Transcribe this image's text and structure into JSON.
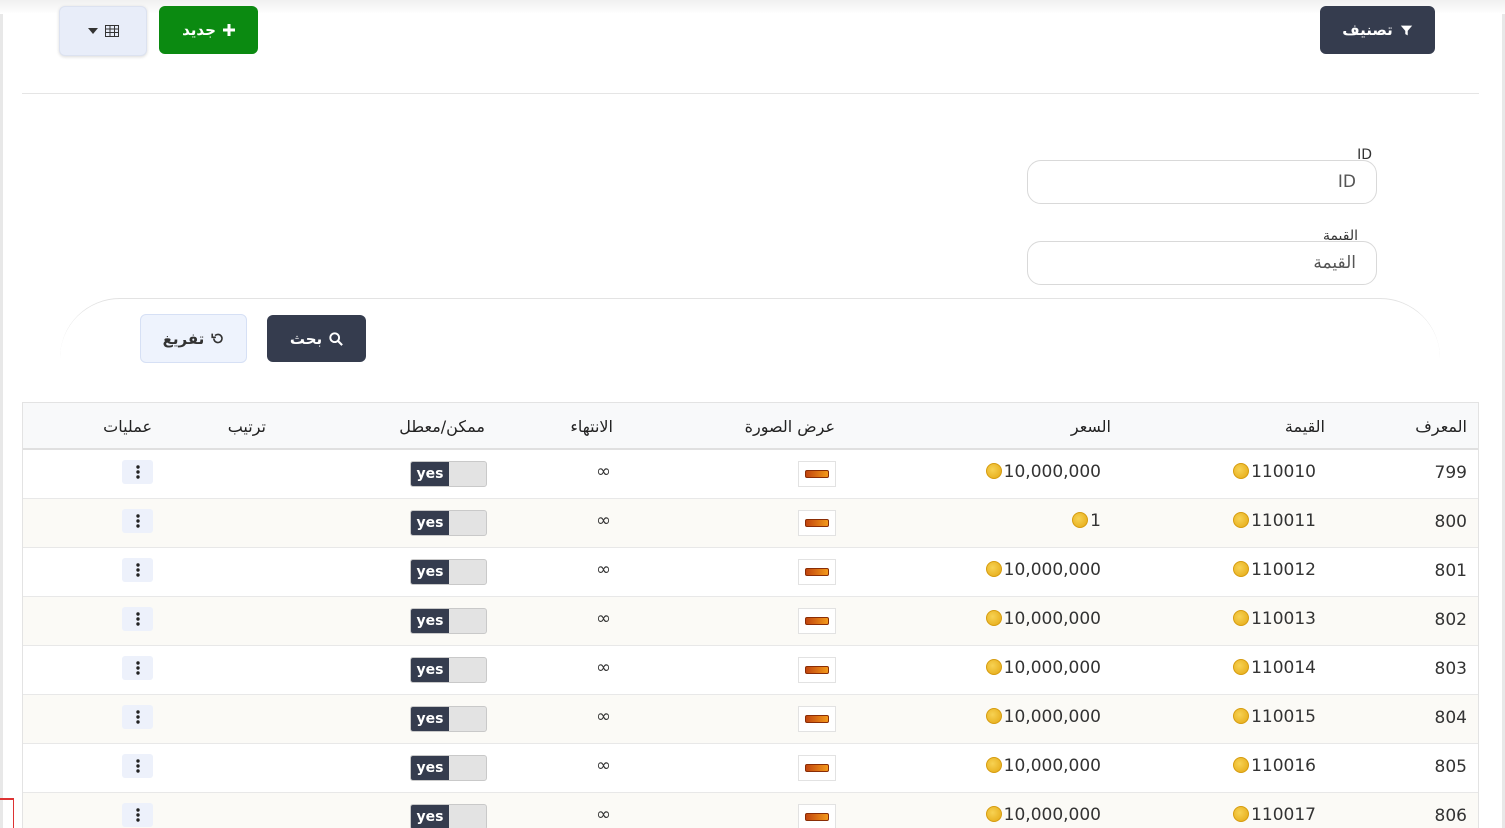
{
  "toolbar": {
    "filter_label": "تصنيف",
    "new_label": "جديد"
  },
  "filters": {
    "id_label": "ID",
    "id_placeholder": "ID",
    "value_label": "القيمة",
    "value_placeholder": "القيمة",
    "search_label": "بحث",
    "reset_label": "تفريغ"
  },
  "table": {
    "headers": {
      "id": "المعرف",
      "value": "القيمة",
      "price": "السعر",
      "image": "عرض الصورة",
      "expiry": "الانتهاء",
      "enabled": "ممكن/معطل",
      "order": "ترتيب",
      "operations": "عمليات"
    },
    "rows": [
      {
        "id": "799",
        "value": "110010",
        "price": "10,000,000",
        "expiry": "∞",
        "enabled": "yes"
      },
      {
        "id": "800",
        "value": "110011",
        "price": "1",
        "expiry": "∞",
        "enabled": "yes"
      },
      {
        "id": "801",
        "value": "110012",
        "price": "10,000,000",
        "expiry": "∞",
        "enabled": "yes"
      },
      {
        "id": "802",
        "value": "110013",
        "price": "10,000,000",
        "expiry": "∞",
        "enabled": "yes"
      },
      {
        "id": "803",
        "value": "110014",
        "price": "10,000,000",
        "expiry": "∞",
        "enabled": "yes"
      },
      {
        "id": "804",
        "value": "110015",
        "price": "10,000,000",
        "expiry": "∞",
        "enabled": "yes"
      },
      {
        "id": "805",
        "value": "110016",
        "price": "10,000,000",
        "expiry": "∞",
        "enabled": "yes"
      },
      {
        "id": "806",
        "value": "110017",
        "price": "10,000,000",
        "expiry": "∞",
        "enabled": "yes"
      }
    ]
  },
  "icons": {
    "filter": "filter-icon",
    "new": "plus-icon",
    "columns": "table-grid-icon",
    "search": "search-icon",
    "reset": "undo-icon",
    "coin": "coin-icon",
    "operations": "kebab-menu-icon"
  },
  "colors": {
    "dark_button": "#353c4e",
    "new_button": "#0b8a11",
    "coin": "#e4a813"
  }
}
